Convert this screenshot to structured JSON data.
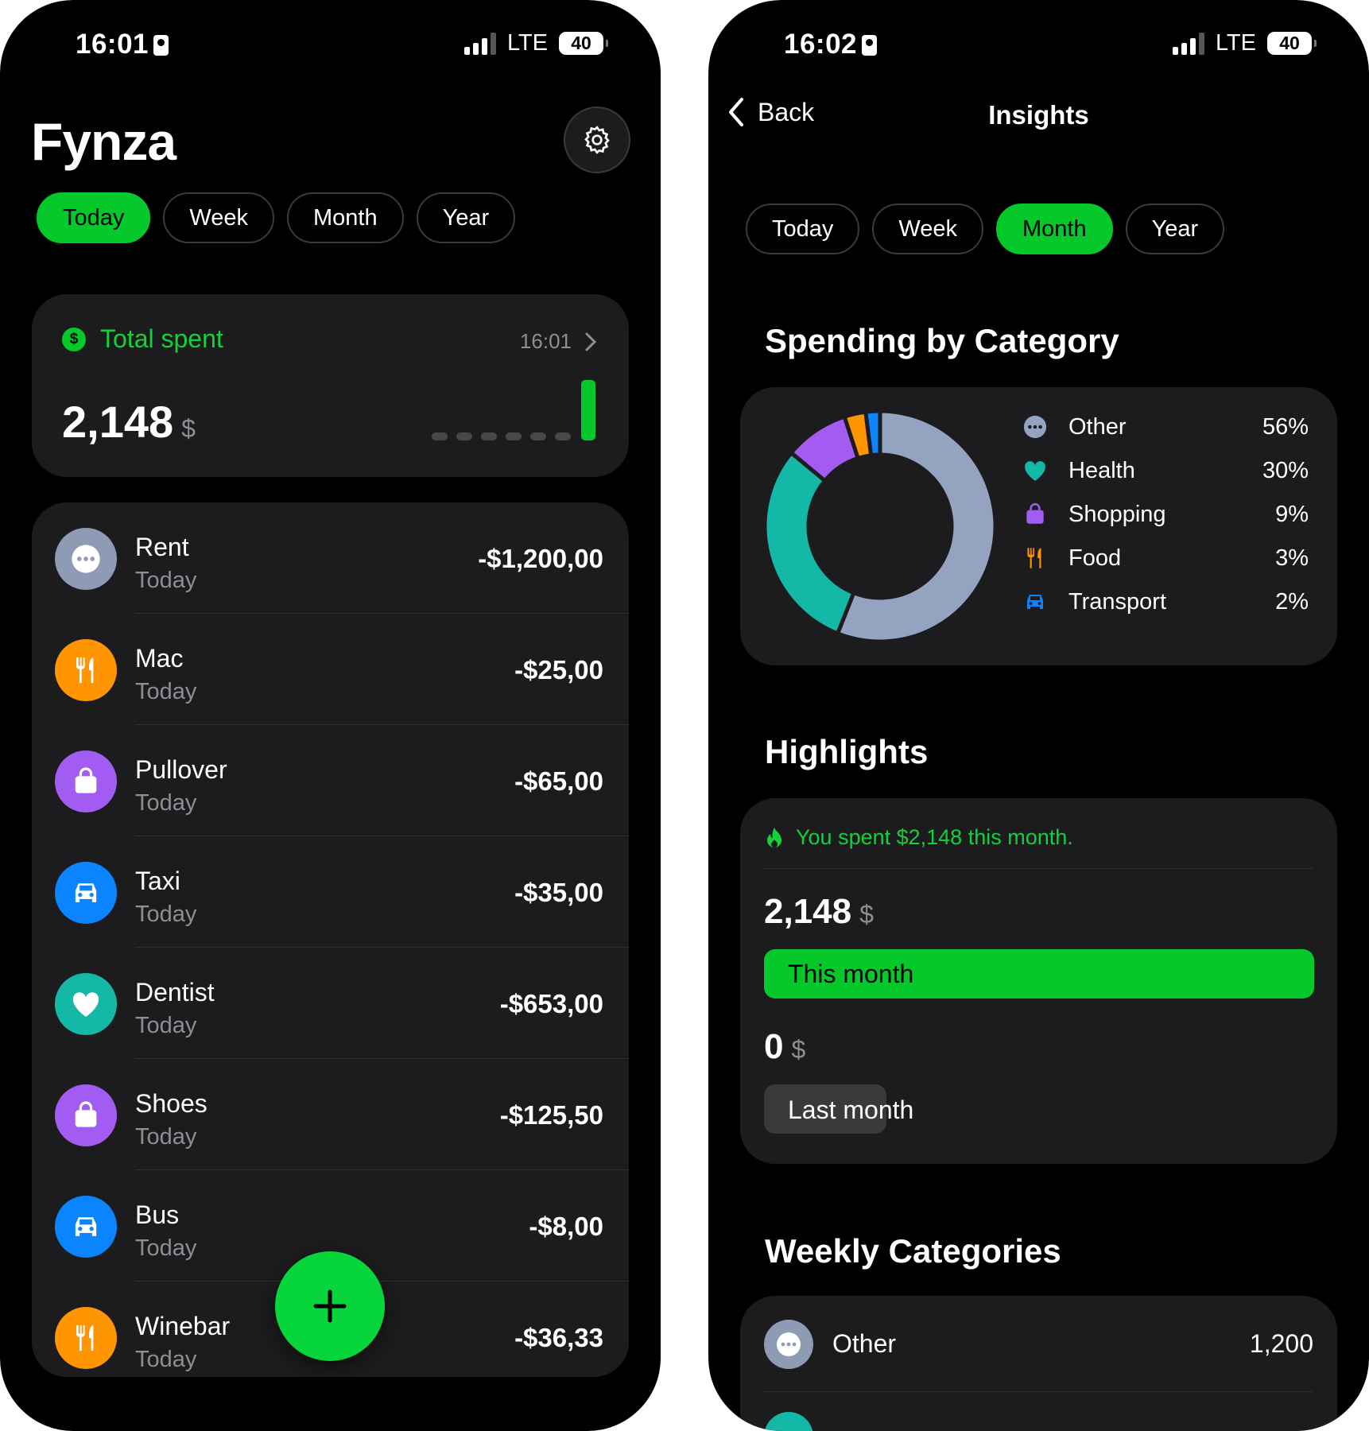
{
  "status_left": {
    "time": "16:01",
    "network": "LTE",
    "battery": "40"
  },
  "status_right": {
    "time": "16:02",
    "network": "LTE",
    "battery": "40"
  },
  "home": {
    "app_title": "Fynza",
    "tabs": [
      "Today",
      "Week",
      "Month",
      "Year"
    ],
    "active_tab": "Today",
    "total": {
      "label": "Total spent",
      "time": "16:01",
      "amount": "2,148",
      "currency": "$",
      "bar_levels": [
        0,
        0,
        0,
        0,
        0,
        0,
        1
      ]
    },
    "transactions": [
      {
        "name": "Rent",
        "date": "Today",
        "amount": "-$1,200,00",
        "icon": "ellipsis-icon",
        "color": "#8e9bb5"
      },
      {
        "name": "Mac",
        "date": "Today",
        "amount": "-$25,00",
        "icon": "fork-knife-icon",
        "color": "#ff9500"
      },
      {
        "name": "Pullover",
        "date": "Today",
        "amount": "-$65,00",
        "icon": "shopping-bag-icon",
        "color": "#a25cf2"
      },
      {
        "name": "Taxi",
        "date": "Today",
        "amount": "-$35,00",
        "icon": "car-icon",
        "color": "#0a84ff"
      },
      {
        "name": "Dentist",
        "date": "Today",
        "amount": "-$653,00",
        "icon": "heart-icon",
        "color": "#13b8a6"
      },
      {
        "name": "Shoes",
        "date": "Today",
        "amount": "-$125,50",
        "icon": "shopping-bag-icon",
        "color": "#a25cf2"
      },
      {
        "name": "Bus",
        "date": "Today",
        "amount": "-$8,00",
        "icon": "car-icon",
        "color": "#0a84ff"
      },
      {
        "name": "Winebar",
        "date": "Today",
        "amount": "-$36,33",
        "icon": "fork-knife-icon",
        "color": "#ff9500"
      }
    ],
    "add_button_icon": "plus-icon"
  },
  "insights": {
    "back_label": "Back",
    "title": "Insights",
    "tabs": [
      "Today",
      "Week",
      "Month",
      "Year"
    ],
    "active_tab": "Month",
    "spending_title": "Spending by Category",
    "highlights_title": "Highlights",
    "weekly_title": "Weekly Categories",
    "highlight_message": "You spent $2,148 this month.",
    "this_month_amount": "2,148",
    "this_month_label": "This month",
    "this_month_fraction": 1,
    "last_month_amount": "0",
    "last_month_label": "Last month",
    "last_month_fraction": 0,
    "currency": "$",
    "weekly": [
      {
        "name": "Other",
        "value": "1,200",
        "icon": "ellipsis-icon",
        "color": "#8e9bb5"
      }
    ]
  },
  "chart_data": {
    "type": "pie",
    "categories": [
      "Other",
      "Health",
      "Shopping",
      "Food",
      "Transport"
    ],
    "values": [
      56,
      30,
      9,
      3,
      2
    ],
    "labels": [
      "56%",
      "30%",
      "9%",
      "3%",
      "2%"
    ],
    "colors": [
      "#94a3c0",
      "#13b8a6",
      "#a25cf2",
      "#ff9500",
      "#0a84ff"
    ],
    "icons": [
      "ellipsis-icon",
      "heart-icon",
      "shopping-bag-icon",
      "fork-knife-icon",
      "car-icon"
    ]
  }
}
